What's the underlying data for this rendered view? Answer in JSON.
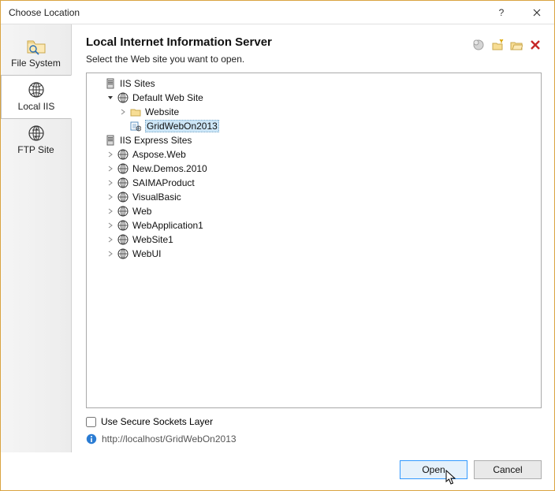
{
  "window": {
    "title": "Choose Location"
  },
  "sidebar": {
    "items": [
      {
        "label": "File System"
      },
      {
        "label": "Local IIS"
      },
      {
        "label": "FTP Site"
      }
    ]
  },
  "content": {
    "heading": "Local Internet Information Server",
    "subtitle": "Select the Web site you want to open."
  },
  "toolbar": {
    "icons": [
      "new-application-icon",
      "new-virtual-directory-icon",
      "open-folder-icon",
      "delete-icon"
    ]
  },
  "tree": {
    "root1": {
      "label": "IIS Sites"
    },
    "defaultSite": {
      "label": "Default Web Site"
    },
    "websiteFolder": {
      "label": "Website"
    },
    "selected": {
      "label": "GridWebOn2013"
    },
    "root2": {
      "label": "IIS Express Sites"
    },
    "express": [
      {
        "label": "Aspose.Web"
      },
      {
        "label": "New.Demos.2010"
      },
      {
        "label": "SAIMAProduct"
      },
      {
        "label": "VisualBasic"
      },
      {
        "label": "Web"
      },
      {
        "label": "WebApplication1"
      },
      {
        "label": "WebSite1"
      },
      {
        "label": "WebUI"
      }
    ]
  },
  "ssl": {
    "label": "Use Secure Sockets Layer",
    "checked": false
  },
  "url": "http://localhost/GridWebOn2013",
  "buttons": {
    "open": "Open",
    "cancel": "Cancel"
  }
}
